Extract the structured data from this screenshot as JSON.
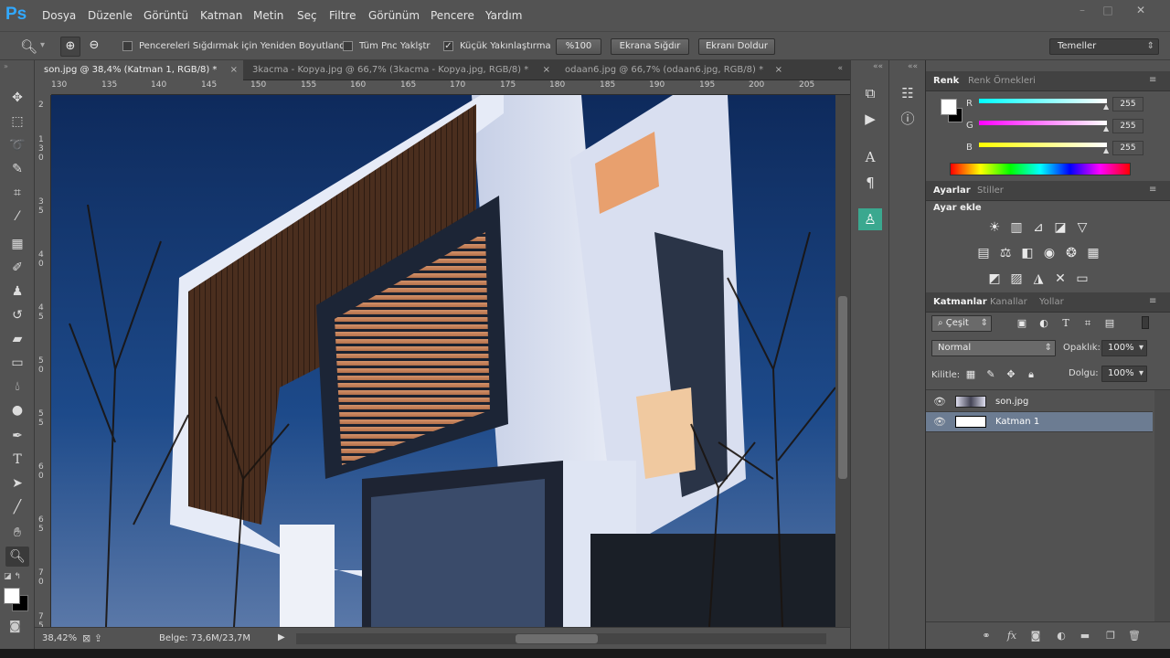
{
  "app": {
    "logo": "Ps"
  },
  "menu": [
    "Dosya",
    "Düzenle",
    "Görüntü",
    "Katman",
    "Metin",
    "Seç",
    "Filtre",
    "Görünüm",
    "Pencere",
    "Yardım"
  ],
  "window_controls": {
    "minimize": "–",
    "restore": "□",
    "close": "✕"
  },
  "options": {
    "resize_windows": {
      "label": "Pencereleri Sığdırmak için Yeniden Boyutlandır",
      "checked": false
    },
    "zoom_all": {
      "label": "Tüm Pnc Yaklştr",
      "checked": false
    },
    "scrubby_zoom": {
      "label": "Küçük Yakınlaştırma",
      "checked": true
    },
    "btn_100": "%100",
    "btn_fit": "Ekrana Sığdır",
    "btn_fill": "Ekranı Doldur",
    "workspace": "Temeller"
  },
  "doc_tabs": [
    {
      "title": "son.jpg @ 38,4% (Katman 1, RGB/8) *",
      "active": true
    },
    {
      "title": "3kacma - Kopya.jpg @ 66,7% (3kacma - Kopya.jpg, RGB/8) *",
      "active": false
    },
    {
      "title": "odaan6.jpg @ 66,7% (odaan6.jpg, RGB/8) *",
      "active": false
    }
  ],
  "ruler": {
    "h": [
      "130",
      "135",
      "140",
      "145",
      "150",
      "155",
      "160",
      "165",
      "170",
      "175",
      "180",
      "185",
      "190",
      "195",
      "200",
      "205"
    ],
    "v": [
      "2",
      "1",
      "3",
      "0",
      "3",
      "5",
      "4",
      "0",
      "4",
      "5",
      "5",
      "0",
      "5",
      "5",
      "6",
      "0",
      "6",
      "5",
      "7",
      "0",
      "7",
      "5"
    ]
  },
  "status": {
    "zoom": "38,42%",
    "doc": "Belge: 73,6M/23,7M"
  },
  "color_panel": {
    "tabs": [
      "Renk",
      "Renk Örnekleri"
    ],
    "channels": [
      {
        "name": "R",
        "value": "255"
      },
      {
        "name": "G",
        "value": "255"
      },
      {
        "name": "B",
        "value": "255"
      }
    ]
  },
  "adjust_panel": {
    "tabs": [
      "Ayarlar",
      "Stiller"
    ],
    "heading": "Ayar ekle"
  },
  "layers_panel": {
    "tabs": [
      "Katmanlar",
      "Kanallar",
      "Yollar"
    ],
    "filter": "Çeşit",
    "blend_mode": "Normal",
    "opacity_label": "Opaklık:",
    "opacity": "100%",
    "lock_label": "Kilitle:",
    "fill_label": "Dolgu:",
    "fill": "100%",
    "layers": [
      {
        "name": "son.jpg",
        "selected": false
      },
      {
        "name": "Katman 1",
        "selected": true
      }
    ]
  },
  "icons": {
    "tools": [
      "move-icon",
      "marquee-icon",
      "lasso-icon",
      "quick-select-icon",
      "crop-icon",
      "eyedropper-icon",
      "healing-icon",
      "brush-icon",
      "stamp-icon",
      "history-brush-icon",
      "eraser-icon",
      "gradient-icon",
      "blur-icon",
      "dodge-icon",
      "pen-icon",
      "type-icon",
      "path-select-icon",
      "line-icon",
      "hand-icon",
      "zoom-icon"
    ]
  }
}
